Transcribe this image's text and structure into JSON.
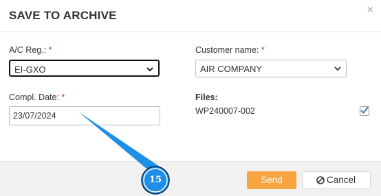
{
  "dialog": {
    "title": "SAVE TO ARCHIVE",
    "close_symbol": "×"
  },
  "form": {
    "ac_reg": {
      "label": "A/C Reg.:",
      "required_mark": "*",
      "value": "EI-GXO"
    },
    "customer": {
      "label": "Customer name:",
      "required_mark": "*",
      "value": "AIR COMPANY"
    },
    "compl_date": {
      "label": "Compl. Date:",
      "required_mark": "*",
      "value": "23/07/2024"
    },
    "files": {
      "label": "Files:",
      "items": [
        {
          "name": "WP240007-002",
          "checked": true
        }
      ]
    }
  },
  "footer": {
    "send_label": "Send",
    "cancel_label": "Cancel"
  },
  "annotation": {
    "step_number": "15",
    "color": "#1e8fe6"
  },
  "colors": {
    "accent_orange": "#f7a540",
    "required_red": "#d9262e",
    "checkmark_blue": "#5b7fb7"
  }
}
